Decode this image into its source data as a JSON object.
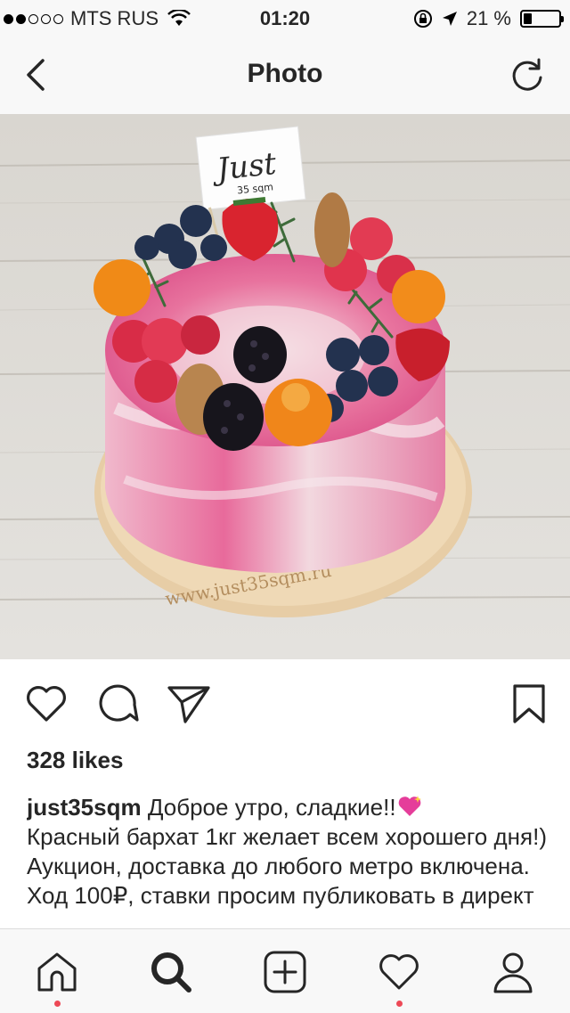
{
  "status_bar": {
    "carrier": "MTS RUS",
    "time": "01:20",
    "battery": "21 %",
    "battery_level": 0.21
  },
  "nav": {
    "title": "Photo"
  },
  "photo": {
    "flag_text": "Just",
    "flag_subtext": "35 sqm",
    "board_text": "www.just35sqm.ru"
  },
  "post": {
    "likes": "328 likes",
    "username": "just35sqm",
    "caption_line1": "Доброе утро, сладкие!!",
    "caption_rest": "Красный бархат 1кг желает всем хорошего дня!) Аукцион, доставка до любого метро включена. Ход 100₽, ставки просим публиковать в директ"
  },
  "icons": {
    "back": "chevron-left-icon",
    "refresh": "refresh-icon",
    "like": "heart-icon",
    "comment": "comment-icon",
    "share": "send-icon",
    "save": "bookmark-icon",
    "tabs": [
      "home-icon",
      "search-icon",
      "add-icon",
      "activity-heart-icon",
      "profile-icon"
    ]
  },
  "colors": {
    "notification_dot": "#ed4956",
    "text": "#262626"
  }
}
